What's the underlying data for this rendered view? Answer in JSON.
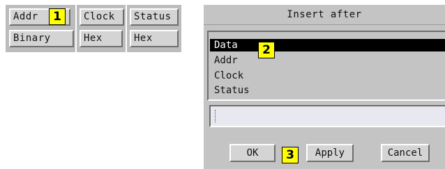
{
  "columns": [
    {
      "name": "Addr",
      "format": "Binary"
    },
    {
      "name": "Clock",
      "format": "Hex"
    },
    {
      "name": "Status",
      "format": "Hex"
    }
  ],
  "callouts": [
    "1",
    "2",
    "3"
  ],
  "dialog": {
    "title": "Insert after",
    "list_items": [
      "Data",
      "Addr",
      "Clock",
      "Status"
    ],
    "selected_index": 0,
    "input_value": "",
    "buttons": {
      "ok": "OK",
      "apply": "Apply",
      "cancel": "Cancel"
    }
  },
  "colors": {
    "callout": "#ffff00",
    "selection": "#000000",
    "panel": "#c4c4c4"
  }
}
